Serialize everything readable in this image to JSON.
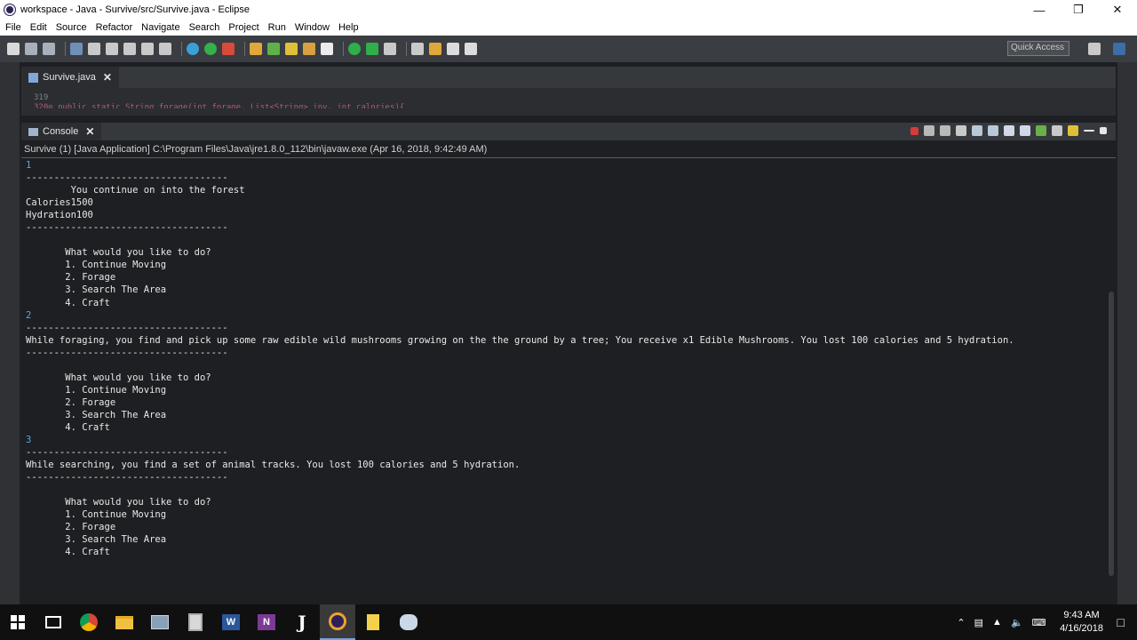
{
  "window": {
    "title": "workspace - Java - Survive/src/Survive.java - Eclipse"
  },
  "menu": [
    "File",
    "Edit",
    "Source",
    "Refactor",
    "Navigate",
    "Search",
    "Project",
    "Run",
    "Window",
    "Help"
  ],
  "quick_access": "Quick Access",
  "editor": {
    "tab_label": "Survive.java",
    "line_319": "319",
    "line_320": "320⊙   public static String forage(int forage, List<String> inv, int calories){"
  },
  "console": {
    "tab_label": "Console",
    "launch_info": "Survive (1) [Java Application] C:\\Program Files\\Java\\jre1.8.0_112\\bin\\javaw.exe (Apr 16, 2018, 9:42:49 AM)",
    "lines": [
      {
        "text": "1",
        "type": "in"
      },
      {
        "text": "------------------------------------",
        "type": "out"
      },
      {
        "text": "        You continue on into the forest",
        "type": "out"
      },
      {
        "text": "Calories1500",
        "type": "out"
      },
      {
        "text": "Hydration100",
        "type": "out"
      },
      {
        "text": "------------------------------------",
        "type": "out"
      },
      {
        "text": "",
        "type": "out"
      },
      {
        "text": "       What would you like to do?",
        "type": "out"
      },
      {
        "text": "       1. Continue Moving",
        "type": "out"
      },
      {
        "text": "       2. Forage",
        "type": "out"
      },
      {
        "text": "       3. Search The Area",
        "type": "out"
      },
      {
        "text": "       4. Craft",
        "type": "out"
      },
      {
        "text": "2",
        "type": "in"
      },
      {
        "text": "------------------------------------",
        "type": "out"
      },
      {
        "text": "While foraging, you find and pick up some raw edible wild mushrooms growing on the the ground by a tree; You receive x1 Edible Mushrooms. You lost 100 calories and 5 hydration.",
        "type": "out"
      },
      {
        "text": "------------------------------------",
        "type": "out"
      },
      {
        "text": "",
        "type": "out"
      },
      {
        "text": "       What would you like to do?",
        "type": "out"
      },
      {
        "text": "       1. Continue Moving",
        "type": "out"
      },
      {
        "text": "       2. Forage",
        "type": "out"
      },
      {
        "text": "       3. Search The Area",
        "type": "out"
      },
      {
        "text": "       4. Craft",
        "type": "out"
      },
      {
        "text": "3",
        "type": "in"
      },
      {
        "text": "------------------------------------",
        "type": "out"
      },
      {
        "text": "While searching, you find a set of animal tracks. You lost 100 calories and 5 hydration.",
        "type": "out"
      },
      {
        "text": "------------------------------------",
        "type": "out"
      },
      {
        "text": "",
        "type": "out"
      },
      {
        "text": "       What would you like to do?",
        "type": "out"
      },
      {
        "text": "       1. Continue Moving",
        "type": "out"
      },
      {
        "text": "       2. Forage",
        "type": "out"
      },
      {
        "text": "       3. Search The Area",
        "type": "out"
      },
      {
        "text": "       4. Craft",
        "type": "out"
      }
    ]
  },
  "taskbar": {
    "apps": [
      "windows-start-icon",
      "task-view-icon",
      "chrome-icon",
      "file-explorer-icon",
      "photos-icon",
      "calculator-icon",
      "word-icon",
      "onenote-icon",
      "java-icon",
      "eclipse-icon",
      "notes-icon",
      "paint-icon"
    ],
    "clock_time": "9:43 AM",
    "clock_date": "4/16/2018"
  },
  "colors": {
    "console_bg": "#1e1f22",
    "toolbar_bg": "#3a3d41",
    "input_text": "#52a8e0"
  }
}
